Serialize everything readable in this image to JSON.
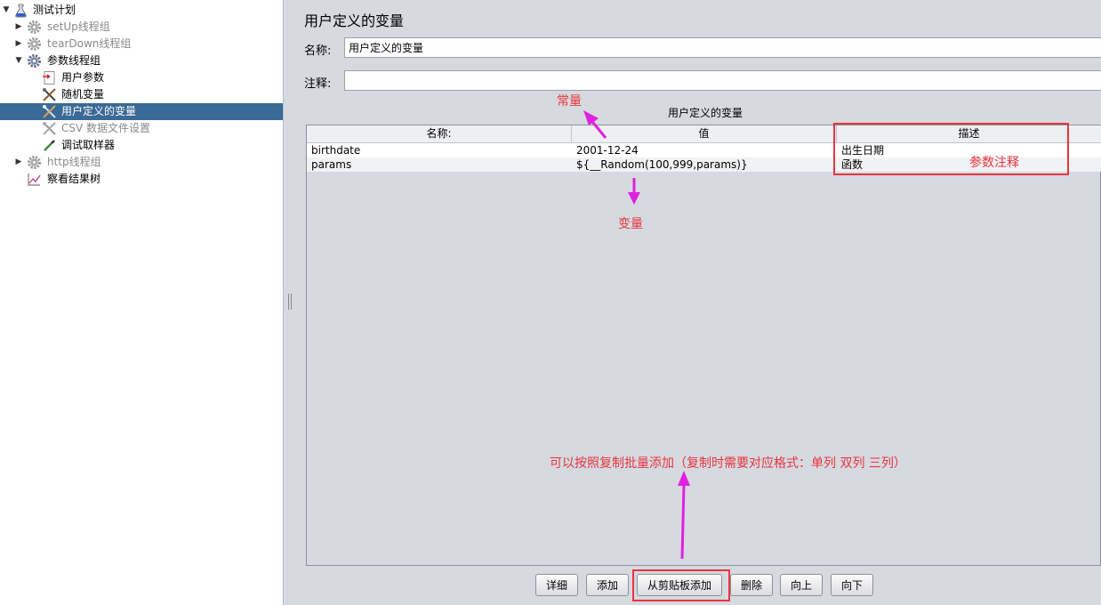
{
  "tree": {
    "root": "测试计划",
    "items": [
      {
        "label": "setUp线程组",
        "disabled": true
      },
      {
        "label": "tearDown线程组",
        "disabled": true
      },
      {
        "label": "参数线程组",
        "disabled": false
      },
      {
        "label": "用户参数",
        "disabled": false
      },
      {
        "label": "随机变量",
        "disabled": false
      },
      {
        "label": "用户定义的变量",
        "disabled": false,
        "selected": true
      },
      {
        "label": "CSV 数据文件设置",
        "disabled": true
      },
      {
        "label": "调试取样器",
        "disabled": false
      },
      {
        "label": "http线程组",
        "disabled": true
      },
      {
        "label": "察看结果树",
        "disabled": false
      }
    ]
  },
  "panel": {
    "title": "用户定义的变量",
    "name_label": "名称:",
    "name_value": "用户定义的变量",
    "comment_label": "注释:",
    "comment_value": "",
    "table_caption": "用户定义的变量"
  },
  "table": {
    "headers": [
      "名称:",
      "值",
      "描述"
    ],
    "rows": [
      [
        "birthdate",
        "2001-12-24",
        "出生日期"
      ],
      [
        "params",
        "${__Random(100,999,params)}",
        "函数"
      ]
    ]
  },
  "buttons": {
    "detail": "详细",
    "add": "添加",
    "add_clipboard": "从剪贴板添加",
    "delete": "删除",
    "up": "向上",
    "down": "向下"
  },
  "annotations": {
    "constant": "常量",
    "variable": "变量",
    "param_comment": "参数注释",
    "clipboard_note": "可以按照复制批量添加（复制时需要对应格式：单列 双列 三列）"
  },
  "colors": {
    "annotation_red": "#e8353f",
    "arrow_magenta": "#e020e0",
    "selection_blue": "#3a6a96"
  }
}
